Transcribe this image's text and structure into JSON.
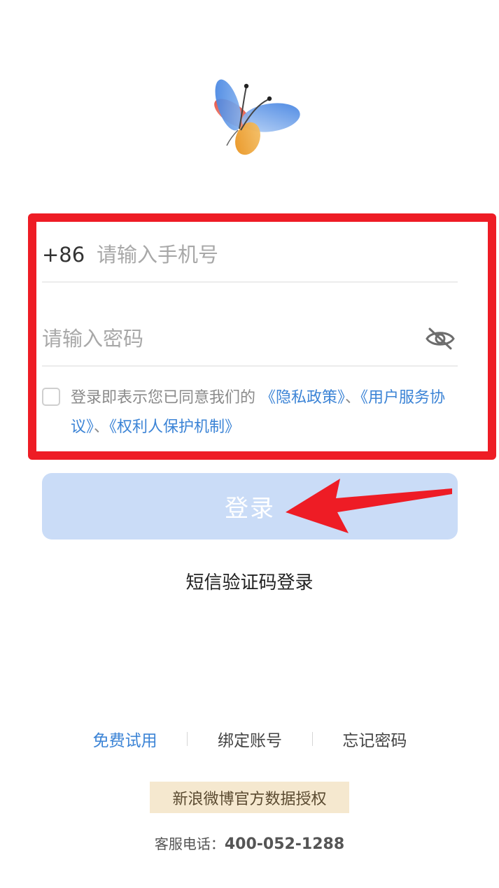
{
  "logo": {
    "icon": "butterfly-logo-icon"
  },
  "form": {
    "country_code": "+86",
    "phone_placeholder": "请输入手机号",
    "password_placeholder": "请输入密码",
    "password_toggle_icon": "eye-off-icon",
    "agreement": {
      "checked": false,
      "prefix": "登录即表示您已同意我们的 ",
      "privacy_policy": "《隐私政策》",
      "sep1": "、",
      "user_agreement": "《用户服务协议》",
      "sep2": "、",
      "rights_protection": "《权利人保护机制》"
    }
  },
  "login_button": {
    "label": "登录"
  },
  "sms_login": {
    "label": "短信验证码登录"
  },
  "bottom_links": {
    "free_trial": "免费试用",
    "bind_account": "绑定账号",
    "forgot_password": "忘记密码"
  },
  "auth_badge": {
    "label": "新浪微博官方数据授权"
  },
  "hotline": {
    "label": "客服电话：",
    "number": "400-052-1288"
  },
  "colors": {
    "annotation_red": "#ee1c25",
    "link_blue": "#3c84d6",
    "button_disabled": "#cadcf7",
    "badge_bg": "#f5e8cf"
  }
}
